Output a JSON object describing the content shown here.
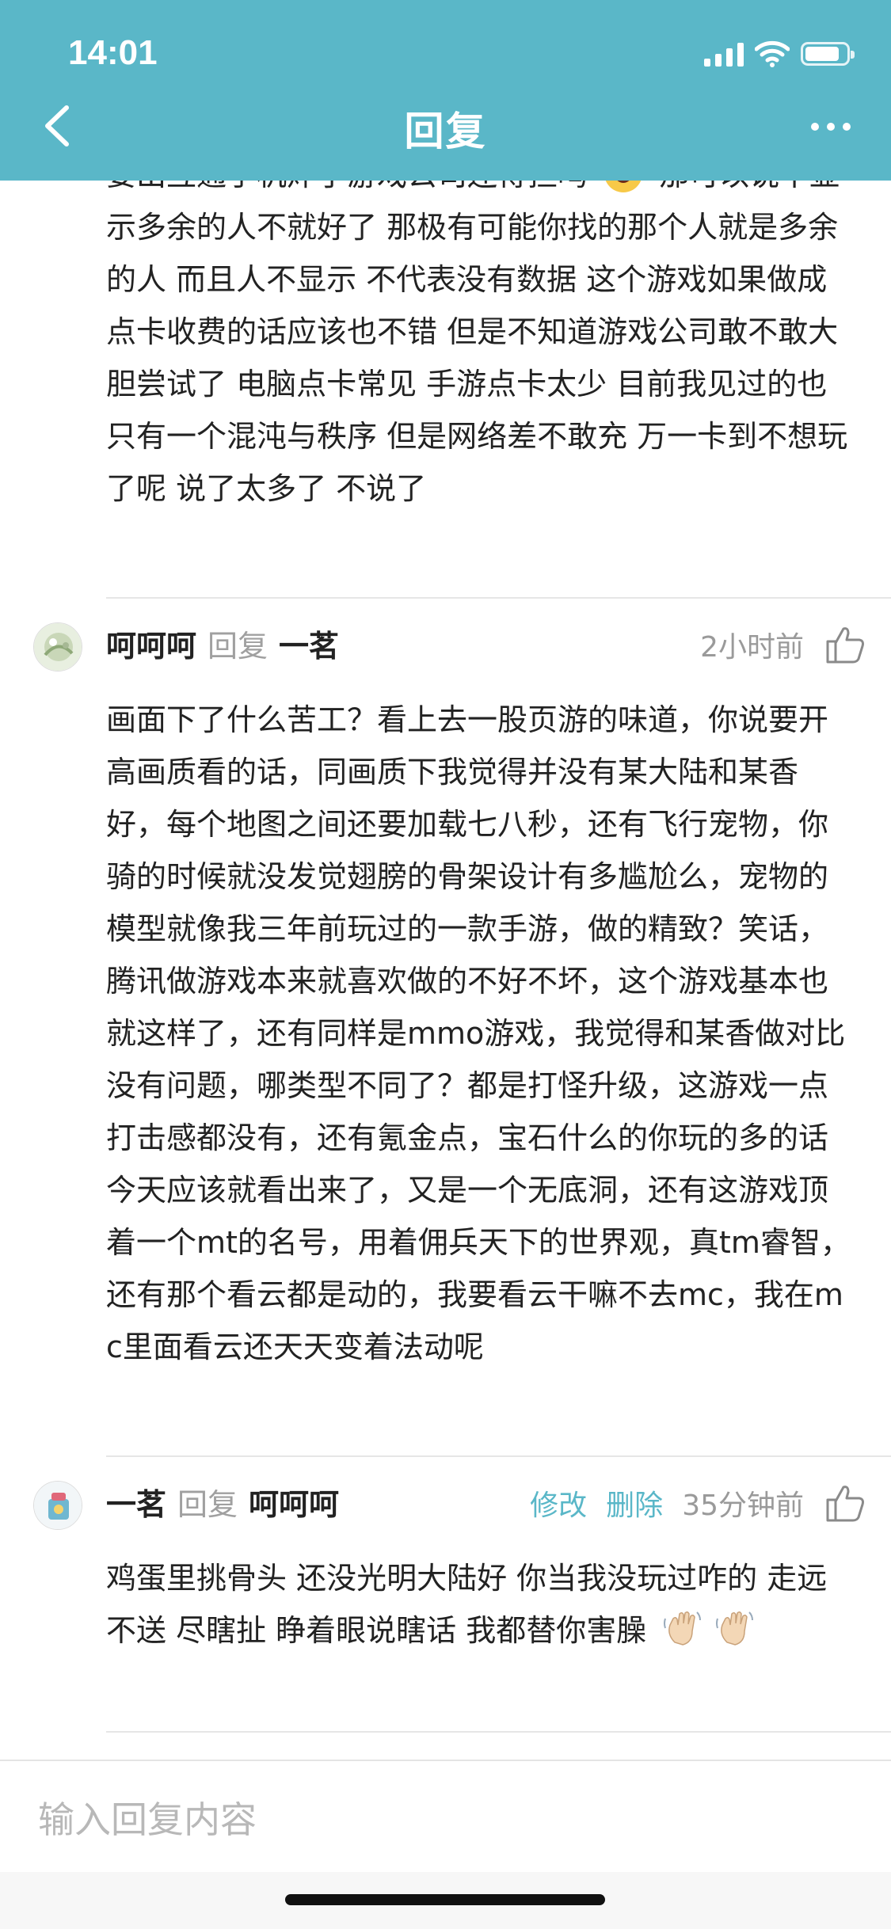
{
  "status_bar": {
    "time": "14:01",
    "battery_level_percent": 85
  },
  "nav": {
    "title": "回复"
  },
  "first_comment": {
    "text": "要出互通手机炸了游戏公司还得担吗 😂 那可以说不显示多余的人不就好了 那极有可能你找的那个人就是多余的人 而且人不显示 不代表没有数据 这个游戏如果做成点卡收费的话应该也不错 但是不知道游戏公司敢不敢大胆尝试了 电脑点卡常见 手游点卡太少 目前我见过的也只有一个混沌与秩序 但是网络差不敢充 万一卡到不想玩了呢 说了太多了 不说了"
  },
  "comments": [
    {
      "author": "呵呵呵",
      "reply_word": "回复",
      "reply_to": "一茗",
      "time": "2小时前",
      "text": "画面下了什么苦工？看上去一股页游的味道，你说要开高画质看的话，同画质下我觉得并没有某大陆和某香好，每个地图之间还要加载七八秒，还有飞行宠物，你骑的时候就没发觉翅膀的骨架设计有多尴尬么，宠物的模型就像我三年前玩过的一款手游，做的精致？笑话，腾讯做游戏本来就喜欢做的不好不坏，这个游戏基本也就这样了，还有同样是mmo游戏，我觉得和某香做对比没有问题，哪类型不同了？都是打怪升级，这游戏一点打击感都没有，还有氪金点，宝石什么的你玩的多的话今天应该就看出来了，又是一个无底洞，还有这游戏顶着一个mt的名号，用着佣兵天下的世界观，真tm睿智，还有那个看云都是动的，我要看云干嘛不去mc，我在mc里面看云还天天变着法动呢"
    },
    {
      "author": "一茗",
      "reply_word": "回复",
      "reply_to": "呵呵呵",
      "edit_label": "修改",
      "delete_label": "删除",
      "time": "35分钟前",
      "text": "鸡蛋里挑骨头 还没光明大陆好 你当我没玩过咋的 走远不送 尽瞎扯 睁着眼说瞎话 我都替你害臊 👋👋"
    }
  ],
  "input": {
    "placeholder": "输入回复内容"
  },
  "icons": {
    "back": "chevron-left-icon",
    "more": "more-dots-icon",
    "like": "thumbs-up-icon",
    "emoji_laugh": "laughing-tears-emoji",
    "emoji_wave": "waving-hand-emoji"
  },
  "colors": {
    "accent": "#5ab7c8",
    "text": "#222222",
    "muted": "#9a9a9a"
  }
}
